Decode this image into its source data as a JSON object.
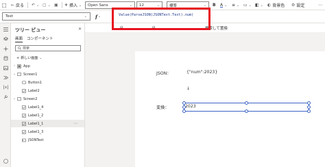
{
  "toolbar": {
    "back": "戻る",
    "insert": "挿入",
    "font_family": "Open Sans",
    "font_size": "12",
    "style": "標準",
    "background_color": "背景色",
    "settings": "設定"
  },
  "formula_bar": {
    "property": "Text",
    "fx": "f",
    "formula": "Value(ParseJSON(JSONText.Text).num)",
    "search_replace": "検索して置換"
  },
  "tree": {
    "title": "ツリー ビュー",
    "tabs": [
      {
        "label": "画面"
      },
      {
        "label": "コンポーネント"
      }
    ],
    "search_placeholder": "検索",
    "new_screen": "新しい画面",
    "nodes": [
      {
        "label": "App"
      },
      {
        "label": "Screen1"
      },
      {
        "label": "Button1"
      },
      {
        "label": "Label2"
      },
      {
        "label": "Screen2"
      },
      {
        "label": "Label1_4"
      },
      {
        "label": "Label1_2"
      },
      {
        "label": "Label1_1"
      },
      {
        "label": "Label1_3"
      },
      {
        "label": "JSONText"
      }
    ]
  },
  "canvas": {
    "json_label": "JSON：",
    "json_value": "{\"num\":2023}",
    "arrow": "↓",
    "convert_label": "変換：",
    "result_value": "2023"
  },
  "colors": {
    "highlight": "#e8141e",
    "selection": "#3b62c4",
    "formula_text": "#1e3a8a"
  }
}
